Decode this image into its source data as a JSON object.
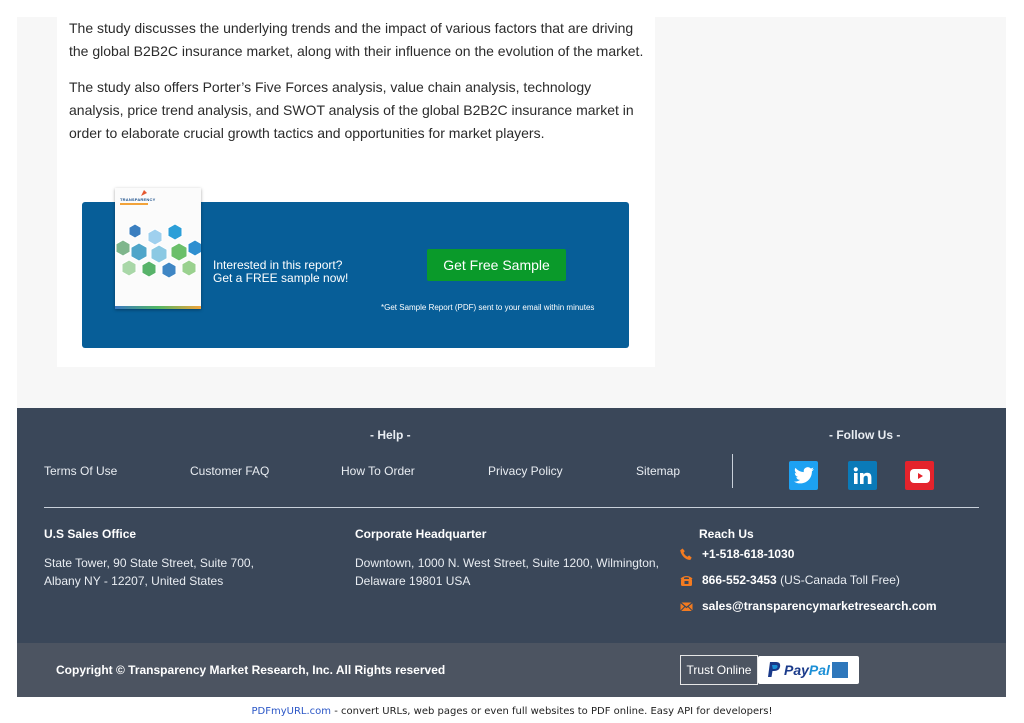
{
  "article": {
    "paragraph1": "The study discusses the underlying trends and the impact of various factors that are driving the global B2B2C insurance market, along with their influence on the evolution of the market.",
    "paragraph2": "The study also offers Porter’s Five Forces analysis, value chain analysis, technology analysis, price trend analysis, and SWOT analysis of the global B2B2C insurance market in order to elaborate crucial growth tactics and opportunities for market players."
  },
  "promo": {
    "cover_brand": "TRANSPARENCY",
    "line1": "Interested in this report?",
    "line2": "Get a FREE sample now!",
    "button_label": "Get Free Sample",
    "note": "*Get Sample Report (PDF) sent to your email within minutes"
  },
  "footer": {
    "help_title": "- Help -",
    "follow_title": "- Follow Us -",
    "links": [
      "Terms Of Use",
      "Customer FAQ",
      "How To Order",
      "Privacy Policy",
      "Sitemap"
    ],
    "social": [
      "twitter-icon",
      "linkedin-icon",
      "youtube-icon"
    ],
    "us_office": {
      "title": "U.S Sales Office",
      "line1": "State Tower, 90 State Street, Suite 700,",
      "line2": "Albany NY - 12207, United States"
    },
    "hq": {
      "title": "Corporate Headquarter",
      "line1": "Downtown, 1000 N. West Street, Suite 1200, Wilmington,",
      "line2": "Delaware 19801 USA"
    },
    "reach": {
      "title": "Reach Us",
      "phone": "+1-518-618-1030",
      "tollfree": "866-552-3453",
      "tollfree_note": "(US-Canada Toll Free)",
      "email": "sales@transparencymarketresearch.com"
    },
    "copyright": "Copyright © Transparency Market Research, Inc. All Rights reserved",
    "trust_label": "Trust Online",
    "paypal_part1": "Pay",
    "paypal_part2": "Pal"
  },
  "pdf_note": {
    "link": "PDFmyURL.com",
    "text": " - convert URLs, web pages or even full websites to PDF online. Easy API for developers!"
  },
  "colors": {
    "promo_blue": "#075e98",
    "button_green": "#0a9a2a",
    "footer_bg": "#3a4759",
    "bottom_bar": "#4c5461",
    "icon_orange": "#f47b20"
  }
}
